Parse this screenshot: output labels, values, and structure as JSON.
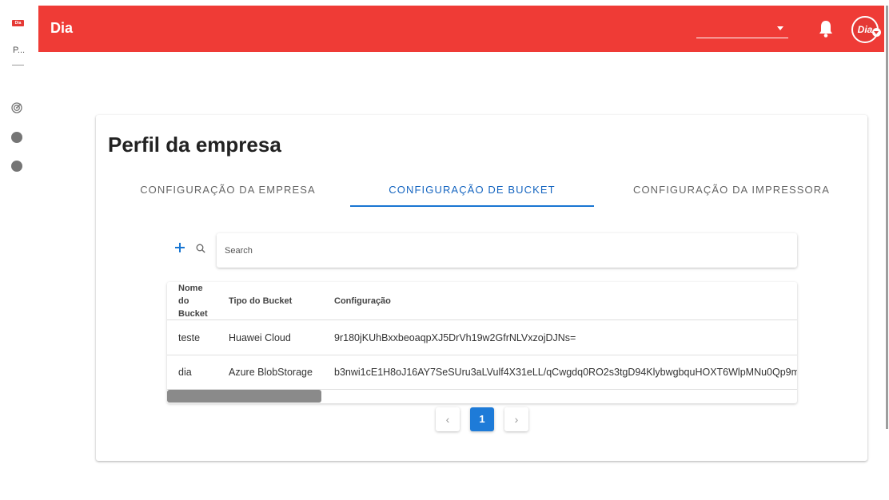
{
  "sidebar": {
    "logo_text": "Dia",
    "profile_label": "P...",
    "items": [
      {
        "icon": "radar-icon"
      },
      {
        "icon": "circle-icon"
      },
      {
        "icon": "circle-icon"
      }
    ]
  },
  "header": {
    "title": "Dia",
    "select_value": "",
    "avatar_text": "Dia",
    "color": "#ef3b36"
  },
  "page": {
    "title": "Perfil da empresa",
    "tabs": [
      {
        "label": "CONFIGURAÇÃO DA EMPRESA",
        "active": false
      },
      {
        "label": "CONFIGURAÇÃO DE BUCKET",
        "active": true
      },
      {
        "label": "CONFIGURAÇÃO DA IMPRESSORA",
        "active": false
      }
    ],
    "accent": "#1976d2"
  },
  "search": {
    "placeholder": "Search",
    "value": ""
  },
  "table": {
    "columns": [
      "Nome do Bucket",
      "Tipo do Bucket",
      "Configuração"
    ],
    "column_name_lines": [
      "Nome",
      "do",
      "Bucket"
    ],
    "rows": [
      {
        "nome": "teste",
        "tipo": "Huawei Cloud",
        "config": "9r180jKUhBxxbeoaqpXJ5DrVh19w2GfrNLVxzojDJNs="
      },
      {
        "nome": "dia",
        "tipo": "Azure BlobStorage",
        "config": "b3nwi1cE1H8oJ16AY7SeSUru3aLVulf4X31eLL/qCwgdq0RO2s3tgD94KlybwgbquHOXT6WlpMNu0Qp9m"
      }
    ]
  },
  "pagination": {
    "prev": "‹",
    "current": "1",
    "next": "›"
  }
}
